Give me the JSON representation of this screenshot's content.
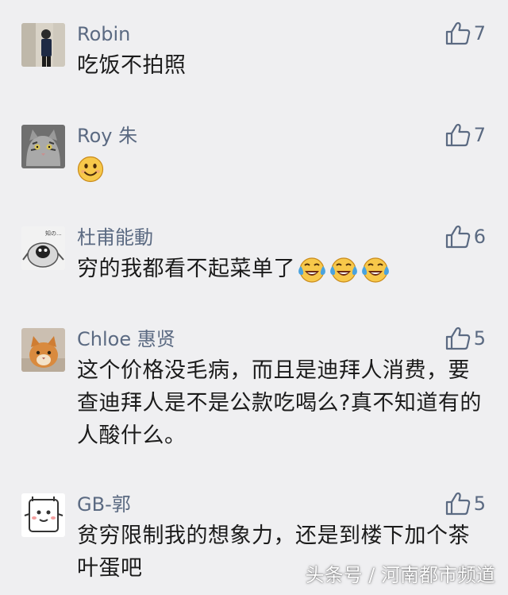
{
  "comments": [
    {
      "name": "Robin",
      "text": "吃饭不拍照",
      "likes": "7"
    },
    {
      "name": "Roy 朱",
      "text": "",
      "likes": "7",
      "emoji": "smile"
    },
    {
      "name": "杜甫能動",
      "text": "穷的我都看不起菜单了",
      "likes": "6",
      "emoji": "laugh-cry"
    },
    {
      "name": "Chloe 惠贤",
      "text": "这个价格没毛病，而且是迪拜人消费，要查迪拜人是不是公款吃喝么?真不知道有的人酸什么。",
      "likes": "5"
    },
    {
      "name": "GB-郭",
      "text": "贫穷限制我的想象力，还是到楼下加个茶叶蛋吧",
      "likes": "5"
    }
  ],
  "watermark": "头条号 / 河南都市频道",
  "colors": {
    "background": "#efeff1",
    "name": "#5b6a82",
    "text": "#1b1b1b",
    "like": "#5b6a82"
  },
  "icons": {
    "like": "thumbs-up-icon",
    "smile": "smile-emoji-icon",
    "laugh_cry": "laugh-cry-emoji-icon"
  }
}
